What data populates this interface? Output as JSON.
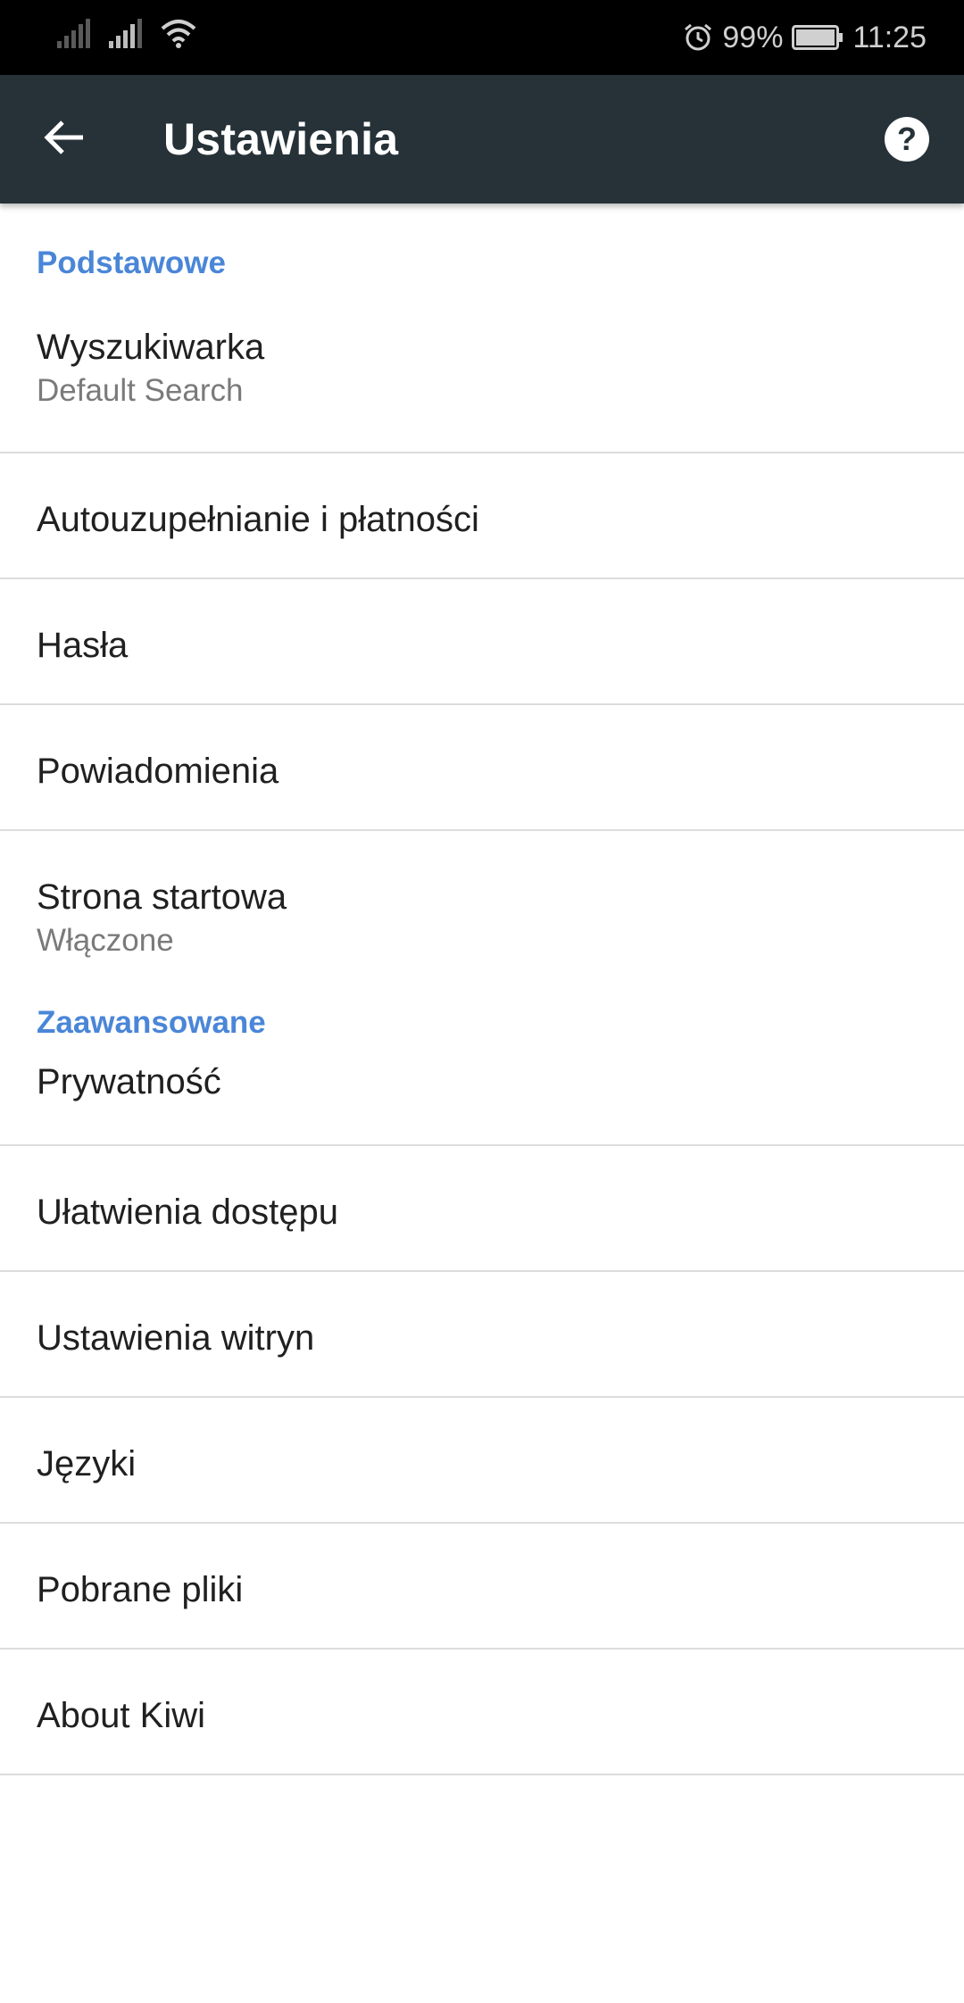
{
  "status_bar": {
    "battery": "99%",
    "time": "11:25",
    "icons": [
      "signal-icon",
      "signal-icon",
      "wifi-icon",
      "alarm-icon",
      "battery-icon"
    ]
  },
  "appbar": {
    "title": "Ustawienia",
    "back_icon": "arrow-back-icon",
    "help_icon": "help-icon",
    "background": "#263238"
  },
  "sections": {
    "basic": {
      "header": "Podstawowe",
      "items": [
        {
          "title": "Wyszukiwarka",
          "subtitle": "Default Search"
        },
        {
          "title": "Autouzupełnianie i płatności"
        },
        {
          "title": "Hasła"
        },
        {
          "title": "Powiadomienia"
        },
        {
          "title": "Strona startowa",
          "subtitle": "Włączone"
        }
      ]
    },
    "advanced": {
      "header": "Zaawansowane",
      "items": [
        {
          "title": "Prywatność"
        },
        {
          "title": "Ułatwienia dostępu"
        },
        {
          "title": "Ustawienia witryn"
        },
        {
          "title": "Języki"
        },
        {
          "title": "Pobrane pliki"
        },
        {
          "title": "About Kiwi"
        }
      ]
    }
  },
  "colors": {
    "accent": "#4a86d8",
    "divider": "#dcdcdc"
  }
}
